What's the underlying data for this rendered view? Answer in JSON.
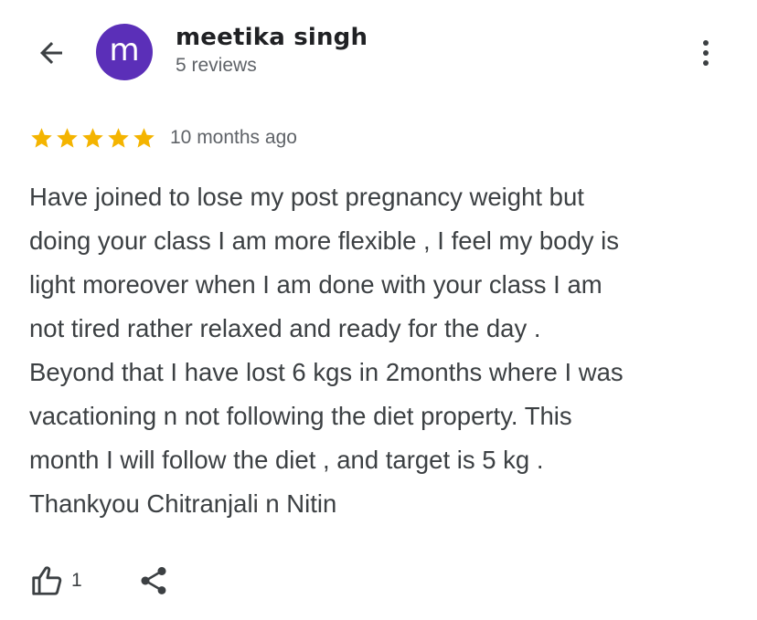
{
  "header": {
    "back_icon": "arrow-left-icon",
    "avatar_letter": "m",
    "avatar_color": "#5b2fb8",
    "reviewer_name": "meetika singh",
    "reviews_count": "5 reviews",
    "more_icon": "more-vertical-icon"
  },
  "review": {
    "rating": 5,
    "max_rating": 5,
    "star_color": "#f4b400",
    "time_ago": "10 months ago",
    "lines": [
      "Have joined to lose my post pregnancy weight but",
      "doing your class I am more flexible , I feel my body is",
      "light moreover when I am done with your class I am",
      "not tired rather relaxed and ready for the day .",
      "Beyond that I have lost 6 kgs in 2months where I was",
      "vacationing n not following the diet property. This",
      "month I will follow the diet , and target is 5 kg .",
      "Thankyou Chitranjali n Nitin"
    ]
  },
  "actions": {
    "like_icon": "thumbs-up-icon",
    "like_count": "1",
    "share_icon": "share-icon"
  }
}
